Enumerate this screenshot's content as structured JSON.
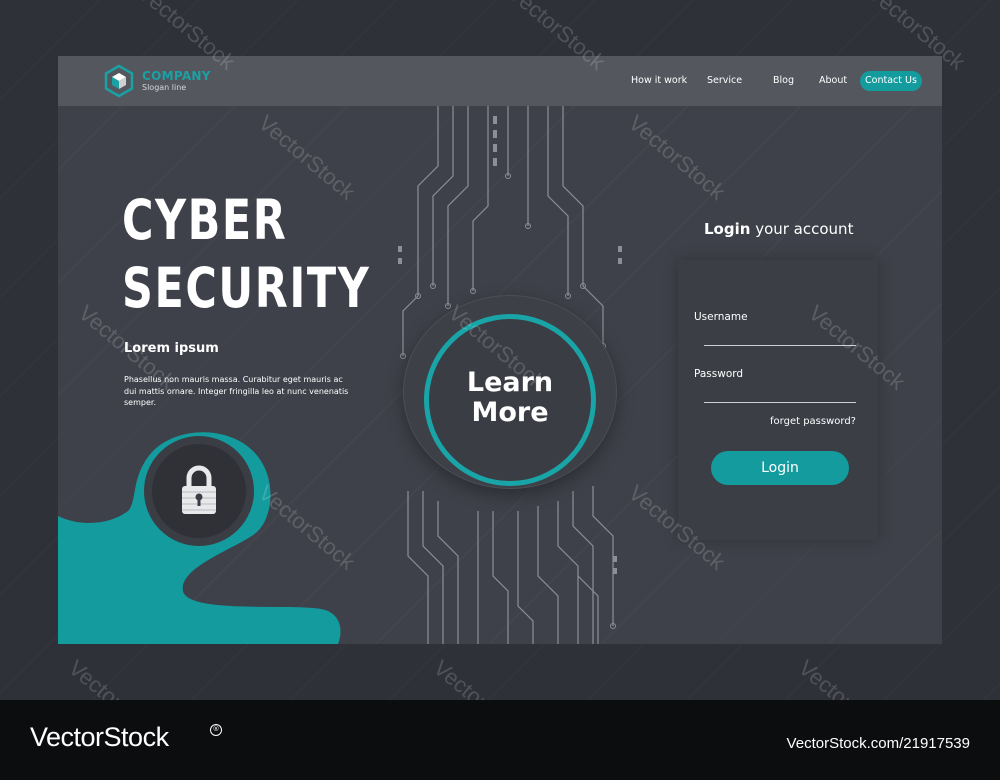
{
  "header": {
    "brand": "COMPANY",
    "tagline": "Slogan line",
    "nav": [
      "How it work",
      "Service",
      "Blog",
      "About"
    ],
    "cta": "Contact Us"
  },
  "hero": {
    "title_line1": "CYBER",
    "title_line2": "SECURITY",
    "subtitle": "Lorem ipsum",
    "body": "Phasellus non mauris massa.  Curabitur eget mauris ac dui mattis ornare. Integer fringilla leo at nunc venenatis semper."
  },
  "cta_circle": {
    "line1": "Learn",
    "line2": "More"
  },
  "login": {
    "title_bold": "Login",
    "title_rest": " your account",
    "username_label": "Username",
    "password_label": "Password",
    "forgot": "forget password?",
    "button": "Login"
  },
  "watermark": "VectorStock",
  "footer": {
    "logo": "VectorStock",
    "reg": "®",
    "url": "VectorStock.com/21917539"
  },
  "colors": {
    "accent": "#139b9e",
    "frame_bg": "#3f414a",
    "header_bg": "#55575f",
    "outer_bg": "#2f3138"
  },
  "icons": {
    "logo": "hexagon-cube-icon",
    "lock": "padlock-icon"
  }
}
